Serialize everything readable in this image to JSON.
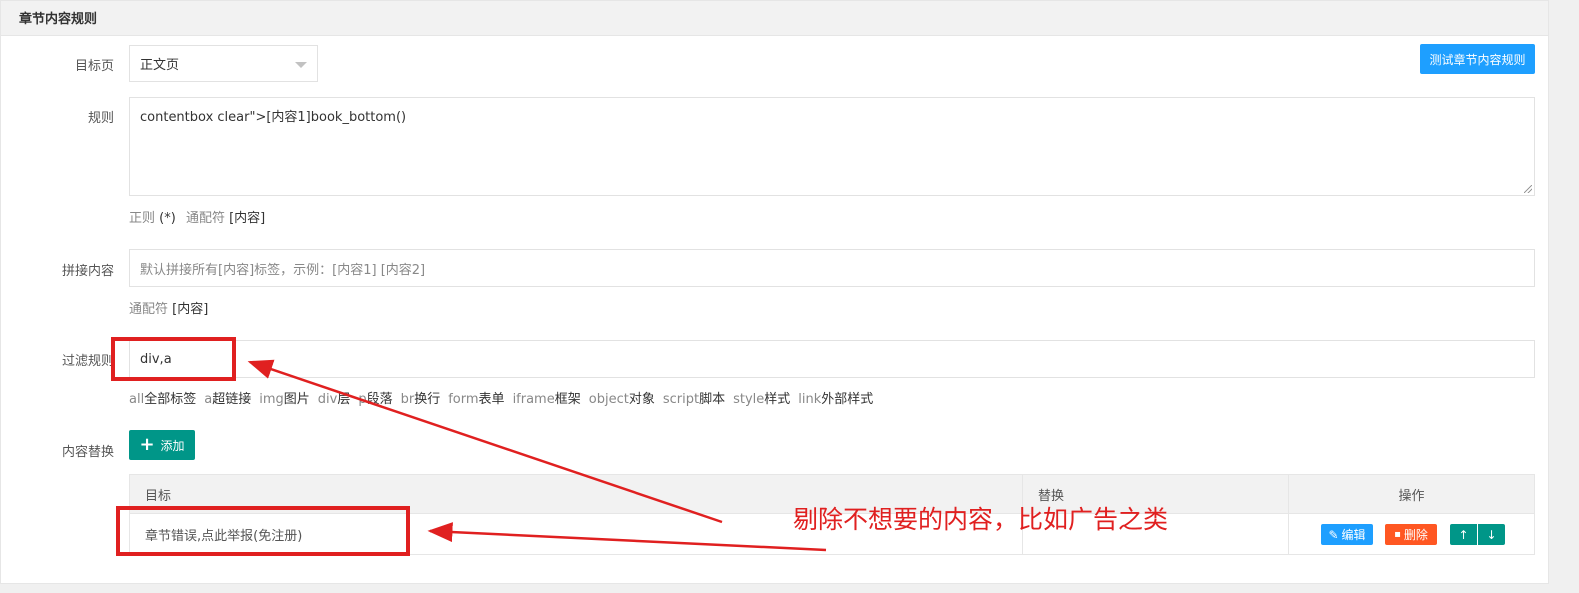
{
  "panel": {
    "title": "章节内容规则"
  },
  "test_button": "测试章节内容规则",
  "target_page": {
    "label": "目标页",
    "value": "正文页"
  },
  "rule": {
    "label": "规则",
    "value": "contentbox clear\">[内容1]book_bottom()",
    "hint": {
      "regex_key": "正则",
      "regex_val": "(*)",
      "wildcard_key": "通配符",
      "wildcard_val": "[内容]"
    }
  },
  "join": {
    "label": "拼接内容",
    "placeholder": "默认拼接所有[内容]标签，示例：[内容1] [内容2]",
    "hint": {
      "wildcard_key": "通配符",
      "wildcard_val": "[内容]"
    }
  },
  "filter": {
    "label": "过滤规则",
    "value": "div,a",
    "tags": [
      {
        "k": "all",
        "v": "全部标签"
      },
      {
        "k": "a",
        "v": "超链接"
      },
      {
        "k": "img",
        "v": "图片"
      },
      {
        "k": "div",
        "v": "层"
      },
      {
        "k": "p",
        "v": "段落"
      },
      {
        "k": "br",
        "v": "换行"
      },
      {
        "k": "form",
        "v": "表单"
      },
      {
        "k": "iframe",
        "v": "框架"
      },
      {
        "k": "object",
        "v": "对象"
      },
      {
        "k": "script",
        "v": "脚本"
      },
      {
        "k": "style",
        "v": "样式"
      },
      {
        "k": "link",
        "v": "外部样式"
      }
    ]
  },
  "replace": {
    "label": "内容替换",
    "add_button": "添加",
    "columns": [
      "目标",
      "替换",
      "操作"
    ],
    "rows": [
      {
        "target": "章节错误,点此举报(免注册)",
        "replacement": ""
      }
    ],
    "actions": {
      "edit": "编辑",
      "delete": "删除",
      "up": "↑",
      "down": "↓"
    }
  },
  "annotation": {
    "text": "剔除不想要的内容，比如广告之类",
    "color": "#e02020"
  },
  "colors": {
    "blue": "#1e9fff",
    "teal": "#009688",
    "orange": "#ff5722",
    "annotation_red": "#e02020"
  }
}
